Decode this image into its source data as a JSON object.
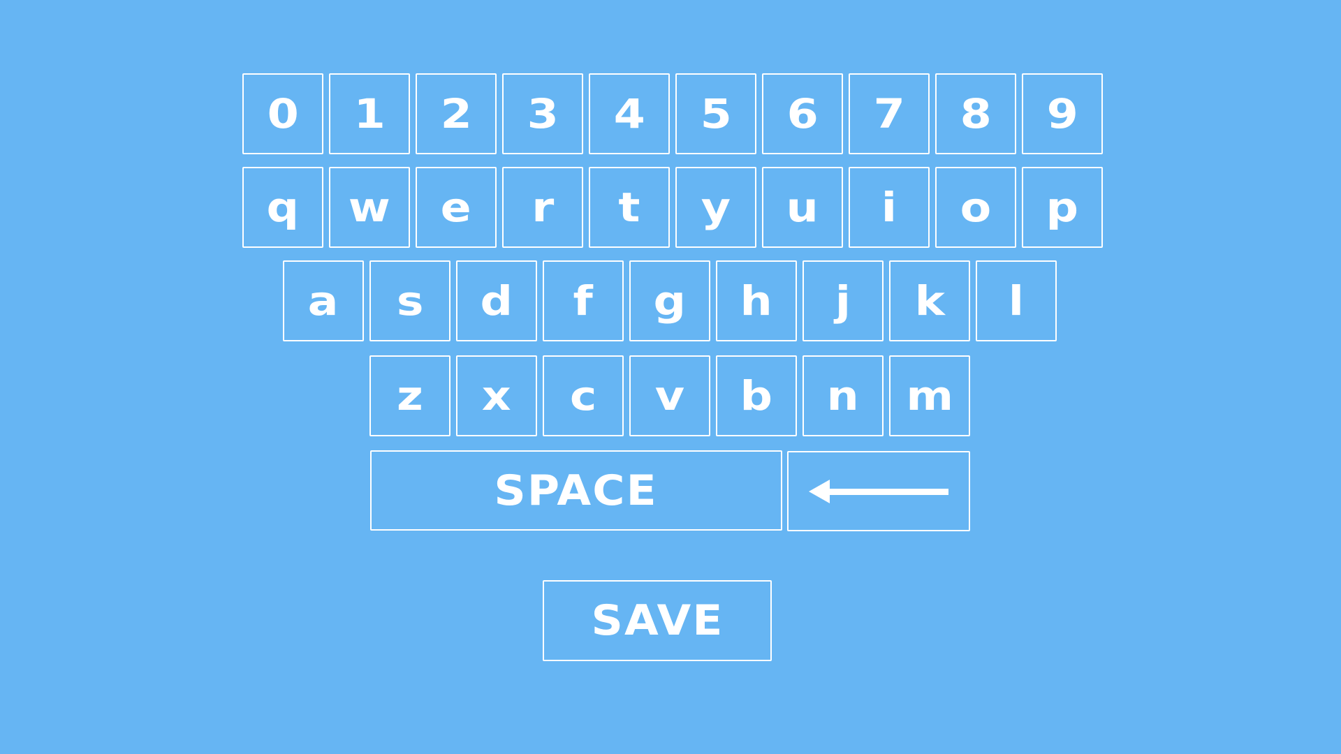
{
  "theme": {
    "background": "#66b5f3",
    "foreground": "#ffffff"
  },
  "keyboard": {
    "row_digits": [
      "0",
      "1",
      "2",
      "3",
      "4",
      "5",
      "6",
      "7",
      "8",
      "9"
    ],
    "row_qwerty": [
      "q",
      "w",
      "e",
      "r",
      "t",
      "y",
      "u",
      "i",
      "o",
      "p"
    ],
    "row_asdf": [
      "a",
      "s",
      "d",
      "f",
      "g",
      "h",
      "j",
      "k",
      "l"
    ],
    "row_zxcv": [
      "z",
      "x",
      "c",
      "v",
      "b",
      "n",
      "m"
    ],
    "space_label": "SPACE",
    "backspace_icon": "left-arrow-icon"
  },
  "actions": {
    "save_label": "SAVE"
  }
}
